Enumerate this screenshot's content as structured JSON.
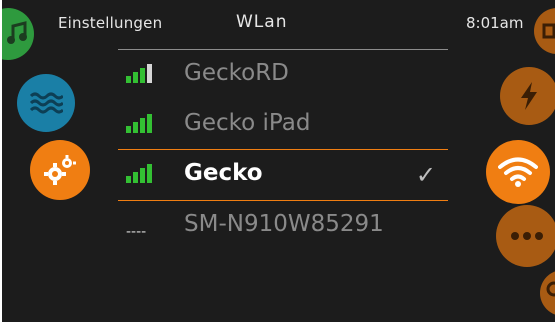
{
  "header": {
    "left_label": "Einstellungen",
    "title": "WLan",
    "time": "8:01am"
  },
  "left_nav": [
    {
      "icon": "music-icon",
      "color": "#2e9a3e"
    },
    {
      "icon": "water-waves-icon",
      "color": "#1a7fa6"
    },
    {
      "icon": "gears-icon",
      "color": "#f07e12"
    }
  ],
  "right_nav": [
    {
      "icon": "partial-top-icon",
      "color": "#a85b13"
    },
    {
      "icon": "lightning-bolt-icon",
      "color": "#a85b13"
    },
    {
      "icon": "wifi-icon",
      "color": "#f07e12"
    },
    {
      "icon": "more-dots-icon",
      "color": "#a85b13"
    },
    {
      "icon": "partial-bottom-icon",
      "color": "#a85b13"
    }
  ],
  "networks": [
    {
      "ssid": "GeckoRD",
      "signal": "strong",
      "selected": false
    },
    {
      "ssid": "Gecko iPad",
      "signal": "strong",
      "selected": false
    },
    {
      "ssid": "Gecko",
      "signal": "strong",
      "selected": true,
      "check": "✓"
    },
    {
      "ssid": "SM-N910W85291",
      "signal": "none",
      "signal_text": "----",
      "selected": false
    }
  ],
  "colors": {
    "background": "#1c1c1c",
    "accent": "#f07e12",
    "signal": "#33c033",
    "divider": "#8c8c8c"
  }
}
